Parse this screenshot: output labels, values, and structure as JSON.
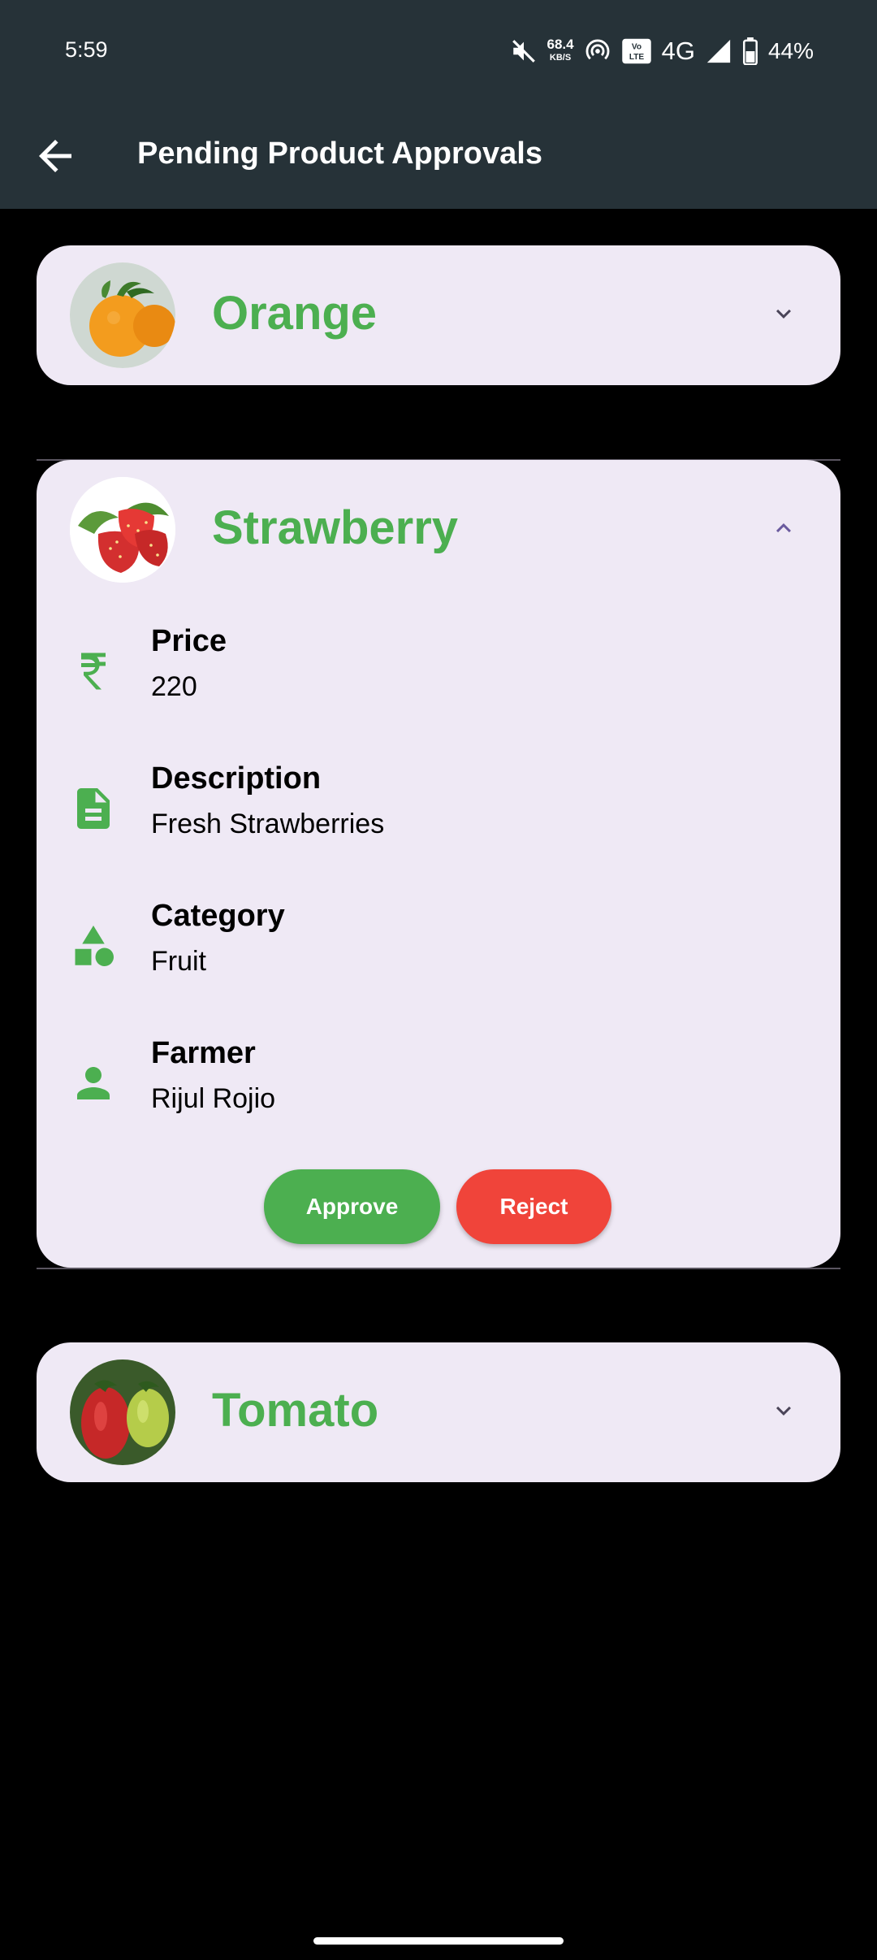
{
  "status_bar": {
    "time": "5:59",
    "speed_value": "68.4",
    "speed_unit": "KB/S",
    "network": "4G",
    "battery": "44%",
    "icons": [
      "mute-icon",
      "hotspot-icon",
      "volte-icon",
      "signal-icon",
      "battery-icon"
    ]
  },
  "app_bar": {
    "title": "Pending Product Approvals",
    "back_icon": "arrow-left-icon"
  },
  "colors": {
    "appbar": "#263238",
    "card": "#efe9f5",
    "accent_green": "#4caf50",
    "reject_red": "#f0443a",
    "chevron": "#4a4458",
    "chevron_expanded": "#6a5a9e"
  },
  "products": [
    {
      "name": "Orange",
      "expanded": false,
      "image": "orange-image"
    },
    {
      "name": "Strawberry",
      "expanded": true,
      "image": "strawberry-image",
      "details": [
        {
          "label": "Price",
          "value": "220",
          "icon": "rupee-icon"
        },
        {
          "label": "Description",
          "value": "Fresh Strawberries",
          "icon": "document-icon"
        },
        {
          "label": "Category",
          "value": "Fruit",
          "icon": "category-shapes-icon"
        },
        {
          "label": "Farmer",
          "value": "Rijul Rojio",
          "icon": "person-icon"
        }
      ],
      "actions": {
        "approve": "Approve",
        "reject": "Reject"
      }
    },
    {
      "name": "Tomato",
      "expanded": false,
      "image": "tomato-image"
    }
  ]
}
